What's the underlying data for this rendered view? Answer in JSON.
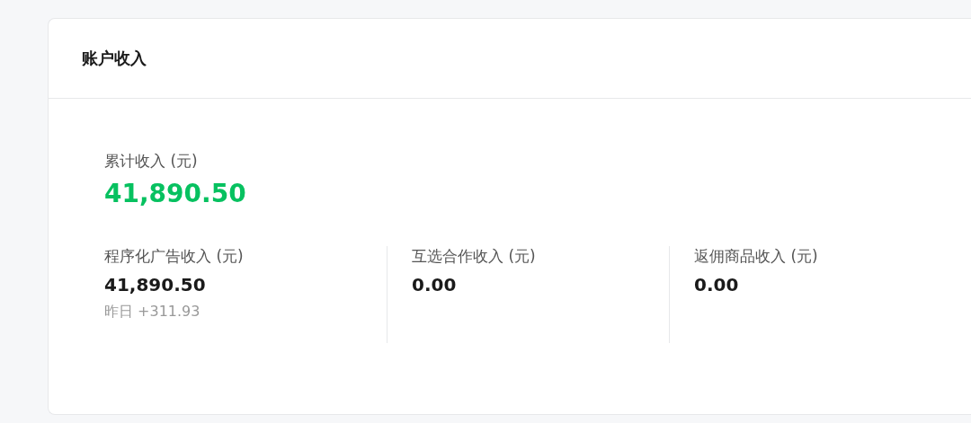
{
  "card": {
    "title": "账户收入"
  },
  "total": {
    "label": "累计收入 (元)",
    "value": "41,890.50"
  },
  "items": [
    {
      "label": "程序化广告收入 (元)",
      "value": "41,890.50",
      "note": "昨日 +311.93"
    },
    {
      "label": "互选合作收入 (元)",
      "value": "0.00"
    },
    {
      "label": "返佣商品收入 (元)",
      "value": "0.00"
    }
  ]
}
